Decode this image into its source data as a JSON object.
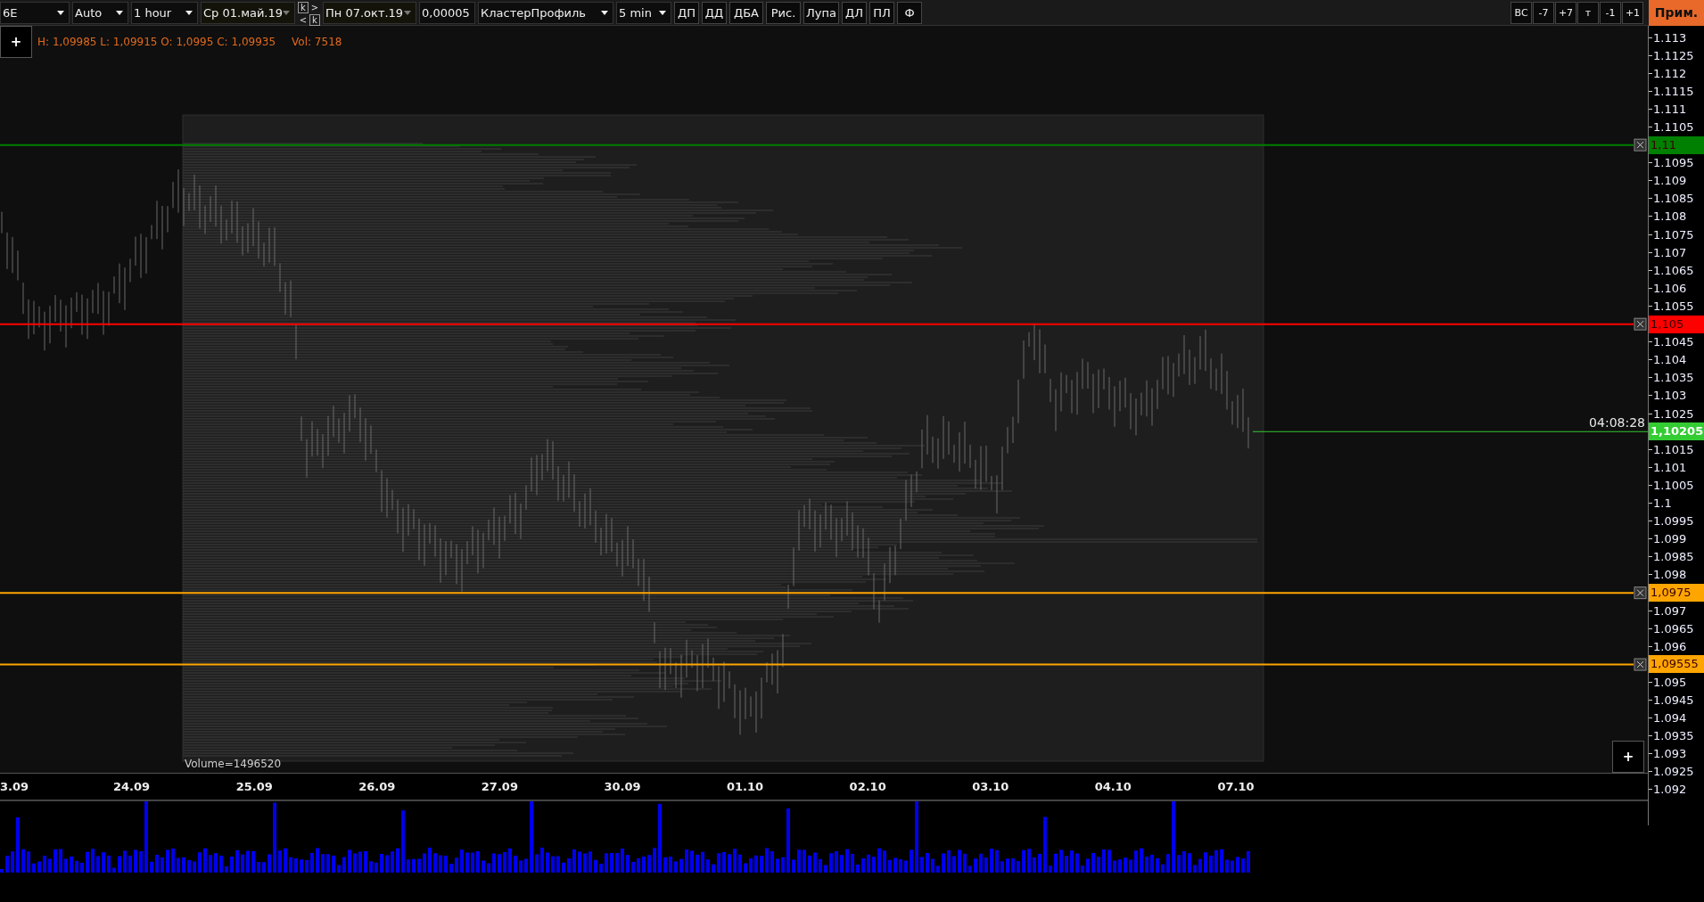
{
  "toolbar": {
    "controls": [
      {
        "kind": "dropdown",
        "value": "6E"
      },
      {
        "kind": "dropdown",
        "value": "Auto"
      },
      {
        "kind": "dropdown",
        "value": "1 hour"
      },
      {
        "kind": "date",
        "value": "Ср 01.май.19"
      },
      {
        "kind": "nav",
        "keys": [
          {
            "label": "k",
            "kind": "key"
          },
          {
            "label": ">",
            "kind": "arrow"
          },
          {
            "label": "<",
            "kind": "arrow"
          },
          {
            "label": "k",
            "kind": "key"
          }
        ]
      },
      {
        "kind": "date",
        "value": "Пн 07.окт.19"
      },
      {
        "kind": "field",
        "value": "0,00005"
      },
      {
        "kind": "dropdown",
        "value": "КластерПрофиль"
      },
      {
        "kind": "dropdown",
        "value": "5 min"
      }
    ],
    "buttons": [
      "ДП",
      "ДД",
      "ДБА",
      "Рис.",
      "Лупа",
      "ДЛ",
      "ПЛ",
      "Ф"
    ],
    "right_buttons": [
      "ВС",
      "-7",
      "+7",
      "т",
      "-1",
      "+1"
    ],
    "apply_button": "Прим."
  },
  "info": {
    "add_button": "+",
    "ohlc": "H: 1,09985 L: 1,09915 O: 1,0995 C: 1,09935",
    "volume": "Vol: 7518"
  },
  "chart": {
    "profile_label": "Volume=1496520",
    "time_left": "04:08:28",
    "add_button": "+"
  },
  "price_axis": [
    {
      "kind": "tick",
      "label": "1.113"
    },
    {
      "kind": "tick",
      "label": "1.1125"
    },
    {
      "kind": "tick",
      "label": "1.112"
    },
    {
      "kind": "tick",
      "label": "1.1115"
    },
    {
      "kind": "tick",
      "label": "1.111"
    },
    {
      "kind": "tick",
      "label": "1.1105"
    },
    {
      "kind": "level",
      "label": "1,11",
      "color": "#008000"
    },
    {
      "kind": "tick",
      "label": "1.1095"
    },
    {
      "kind": "tick",
      "label": "1.109"
    },
    {
      "kind": "tick",
      "label": "1.1085"
    },
    {
      "kind": "tick",
      "label": "1.108"
    },
    {
      "kind": "tick",
      "label": "1.1075"
    },
    {
      "kind": "tick",
      "label": "1.107"
    },
    {
      "kind": "tick",
      "label": "1.1065"
    },
    {
      "kind": "tick",
      "label": "1.106"
    },
    {
      "kind": "tick",
      "label": "1.1055"
    },
    {
      "kind": "level",
      "label": "1,105",
      "color": "#ff0000"
    },
    {
      "kind": "tick",
      "label": "1.1045"
    },
    {
      "kind": "tick",
      "label": "1.104"
    },
    {
      "kind": "tick",
      "label": "1.1035"
    },
    {
      "kind": "tick",
      "label": "1.103"
    },
    {
      "kind": "tick",
      "label": "1.1025"
    },
    {
      "kind": "current",
      "label": "1,10205",
      "color": "#33cc33"
    },
    {
      "kind": "tick",
      "label": "1.1015"
    },
    {
      "kind": "tick",
      "label": "1.101"
    },
    {
      "kind": "tick",
      "label": "1.1005"
    },
    {
      "kind": "tick",
      "label": "1.1"
    },
    {
      "kind": "tick",
      "label": "1.0995"
    },
    {
      "kind": "tick",
      "label": "1.099"
    },
    {
      "kind": "tick",
      "label": "1.0985"
    },
    {
      "kind": "tick",
      "label": "1.098"
    },
    {
      "kind": "level",
      "label": "1,0975",
      "color": "#ffa500"
    },
    {
      "kind": "tick",
      "label": "1.097"
    },
    {
      "kind": "tick",
      "label": "1.0965"
    },
    {
      "kind": "tick",
      "label": "1.096"
    },
    {
      "kind": "level",
      "label": "1,09555",
      "color": "#ffa500"
    },
    {
      "kind": "tick",
      "label": "1.095"
    },
    {
      "kind": "tick",
      "label": "1.0945"
    },
    {
      "kind": "tick",
      "label": "1.094"
    },
    {
      "kind": "tick",
      "label": "1.0935"
    },
    {
      "kind": "tick",
      "label": "1.093"
    },
    {
      "kind": "tick",
      "label": "1.0925"
    },
    {
      "kind": "tick",
      "label": "1.092"
    }
  ],
  "dates": [
    "3.09",
    "24.09",
    "25.09",
    "26.09",
    "27.09",
    "30.09",
    "01.10",
    "02.10",
    "03.10",
    "04.10",
    "07.10"
  ]
}
